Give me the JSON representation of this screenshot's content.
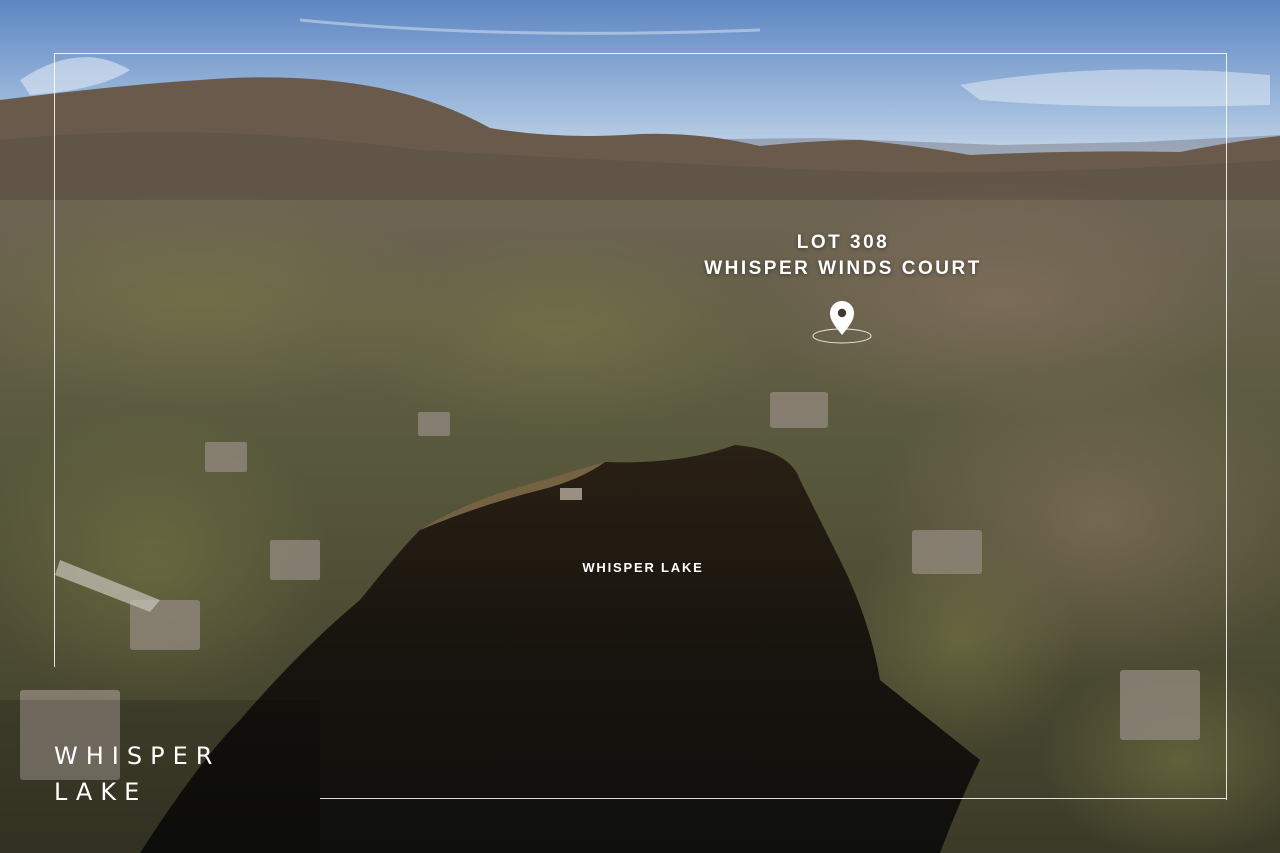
{
  "photo": {
    "subject": "aerial-lake-forest-photo"
  },
  "lot": {
    "line1": "LOT 308",
    "line2": "WHISPER WINDS COURT",
    "marker_icon": "map-pin-icon"
  },
  "lake": {
    "name": "WHISPER LAKE"
  },
  "brand": {
    "line1": "WHISPER",
    "line2": "LAKE"
  },
  "colors": {
    "frame": "#ffffff",
    "text": "#ffffff",
    "water": "#15140f",
    "sky": "#8fb0d6"
  }
}
